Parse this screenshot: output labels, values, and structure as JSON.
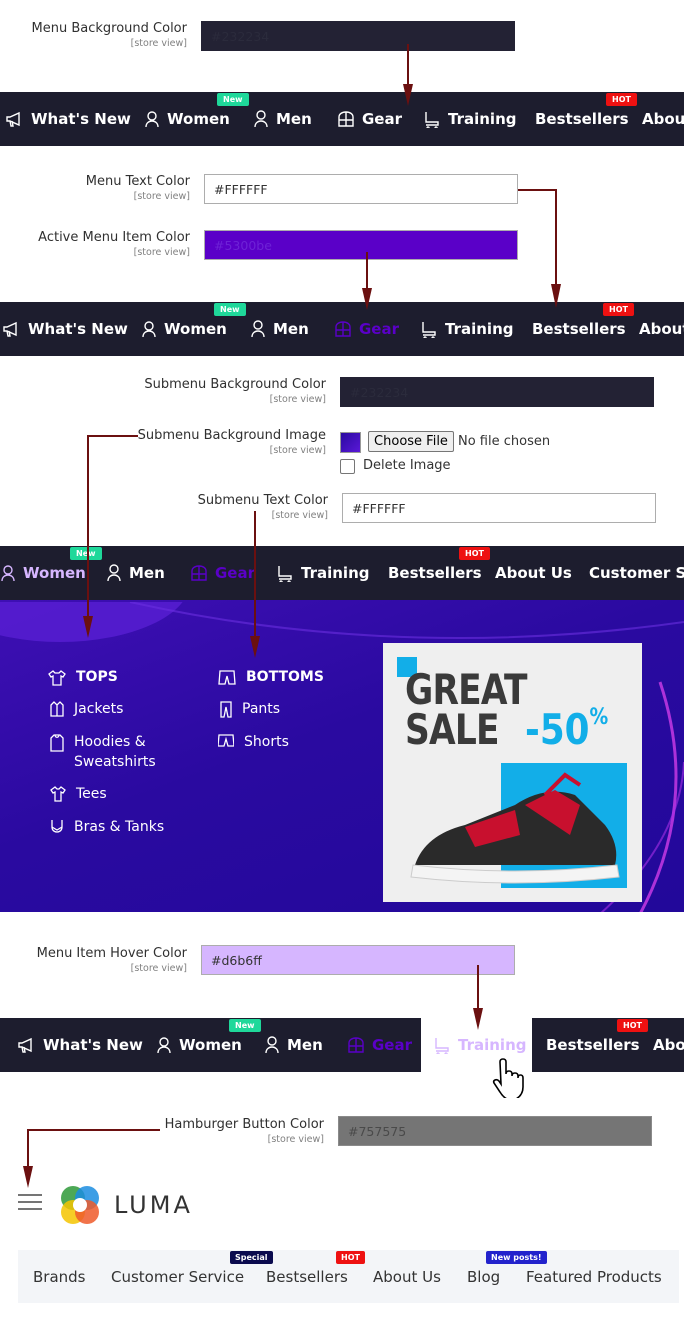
{
  "menu_bg": {
    "label": "Menu Background Color",
    "scope": "[store view]",
    "value": "#232234",
    "color": "#232234"
  },
  "navbar1": {
    "items": [
      "What's New",
      "Women",
      "Men",
      "Gear",
      "Training",
      "Bestsellers",
      "About"
    ],
    "badges": {
      "new": "New",
      "hot": "HOT"
    }
  },
  "menu_text": {
    "label": "Menu Text Color",
    "scope": "[store view]",
    "value": "#FFFFFF"
  },
  "active_menu": {
    "label": "Active Menu Item Color",
    "scope": "[store view]",
    "value": "#5300be",
    "color": "#5a00c8"
  },
  "navbar2": {
    "items": [
      "What's New",
      "Women",
      "Men",
      "Gear",
      "Training",
      "Bestsellers",
      "About"
    ],
    "badges": {
      "new": "New",
      "hot": "HOT"
    }
  },
  "submenu_bg": {
    "label": "Submenu Background Color",
    "scope": "[store view]",
    "value": "#232234"
  },
  "submenu_img": {
    "label": "Submenu Background Image",
    "scope": "[store view]",
    "choose": "Choose File",
    "no_file": "No file chosen",
    "delete": "Delete Image"
  },
  "submenu_text": {
    "label": "Submenu Text Color",
    "scope": "[store view]",
    "value": "#FFFFFF"
  },
  "navbar3": {
    "items": [
      "Women",
      "Men",
      "Gear",
      "Training",
      "Bestsellers",
      "About Us",
      "Customer Ser"
    ],
    "badges": {
      "new": "New",
      "hot": "HOT"
    }
  },
  "mega": {
    "tops": "TOPS",
    "bottoms": "BOTTOMS",
    "tops_items": [
      "Jackets",
      "Hoodies &\nSweatshirts",
      "Tees",
      "Bras & Tanks"
    ],
    "bottoms_items": [
      "Pants",
      "Shorts"
    ],
    "promo": {
      "line1": "GREAT",
      "line2": "SALE",
      "discount": "-50",
      "percent": "%"
    }
  },
  "hover": {
    "label": "Menu Item Hover Color",
    "scope": "[store view]",
    "value": "#d6b6ff",
    "color": "#d6b6ff"
  },
  "navbar4": {
    "items": [
      "What's New",
      "Women",
      "Men",
      "Gear",
      "Training",
      "Bestsellers",
      "Abou"
    ],
    "badges": {
      "new": "New",
      "hot": "HOT"
    }
  },
  "hamburger": {
    "label": "Hamburger Button Color",
    "scope": "[store view]",
    "value": "#757575",
    "color": "#757575"
  },
  "logo": {
    "text": "LUMA"
  },
  "lower_nav": {
    "items": [
      "Brands",
      "Customer Service",
      "Bestsellers",
      "About Us",
      "Blog",
      "Featured Products"
    ],
    "badges": {
      "special": "Special",
      "hot": "HOT",
      "new_posts": "New posts!"
    }
  },
  "colors": {
    "accent_arrow": "#6b1010",
    "active": "#5a00c8",
    "hover": "#d6b6ff",
    "nav_bg": "#1d1d2e"
  }
}
